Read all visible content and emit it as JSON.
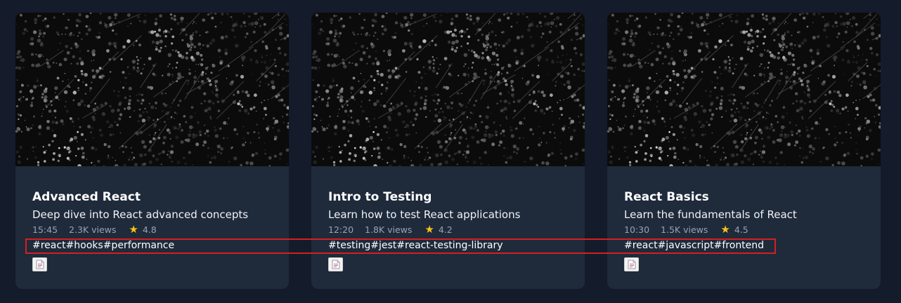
{
  "cards": [
    {
      "title": "Advanced React",
      "description": "Deep dive into React advanced concepts",
      "duration": "15:45",
      "views": "2.3K views",
      "rating": "4.8",
      "tags": [
        "#react",
        "#hooks",
        "#performance"
      ],
      "thumbnail_icon": "forest-thumbnail-image",
      "file_icon": "document-icon"
    },
    {
      "title": "Intro to Testing",
      "description": "Learn how to test React applications",
      "duration": "12:20",
      "views": "1.8K views",
      "rating": "4.2",
      "tags": [
        "#testing",
        "#jest",
        "#react-testing-library"
      ],
      "thumbnail_icon": "forest-thumbnail-image",
      "file_icon": "document-icon"
    },
    {
      "title": "React Basics",
      "description": "Learn the fundamentals of React",
      "duration": "10:30",
      "views": "1.5K views",
      "rating": "4.5",
      "tags": [
        "#react",
        "#javascript",
        "#frontend"
      ],
      "thumbnail_icon": "forest-thumbnail-image",
      "file_icon": "document-icon"
    }
  ],
  "colors": {
    "page_background": "#141b2b",
    "card_background": "#1f2a3b",
    "star": "#f5c518",
    "meta_text": "#9aa3b2",
    "highlight_border": "#d32020"
  }
}
